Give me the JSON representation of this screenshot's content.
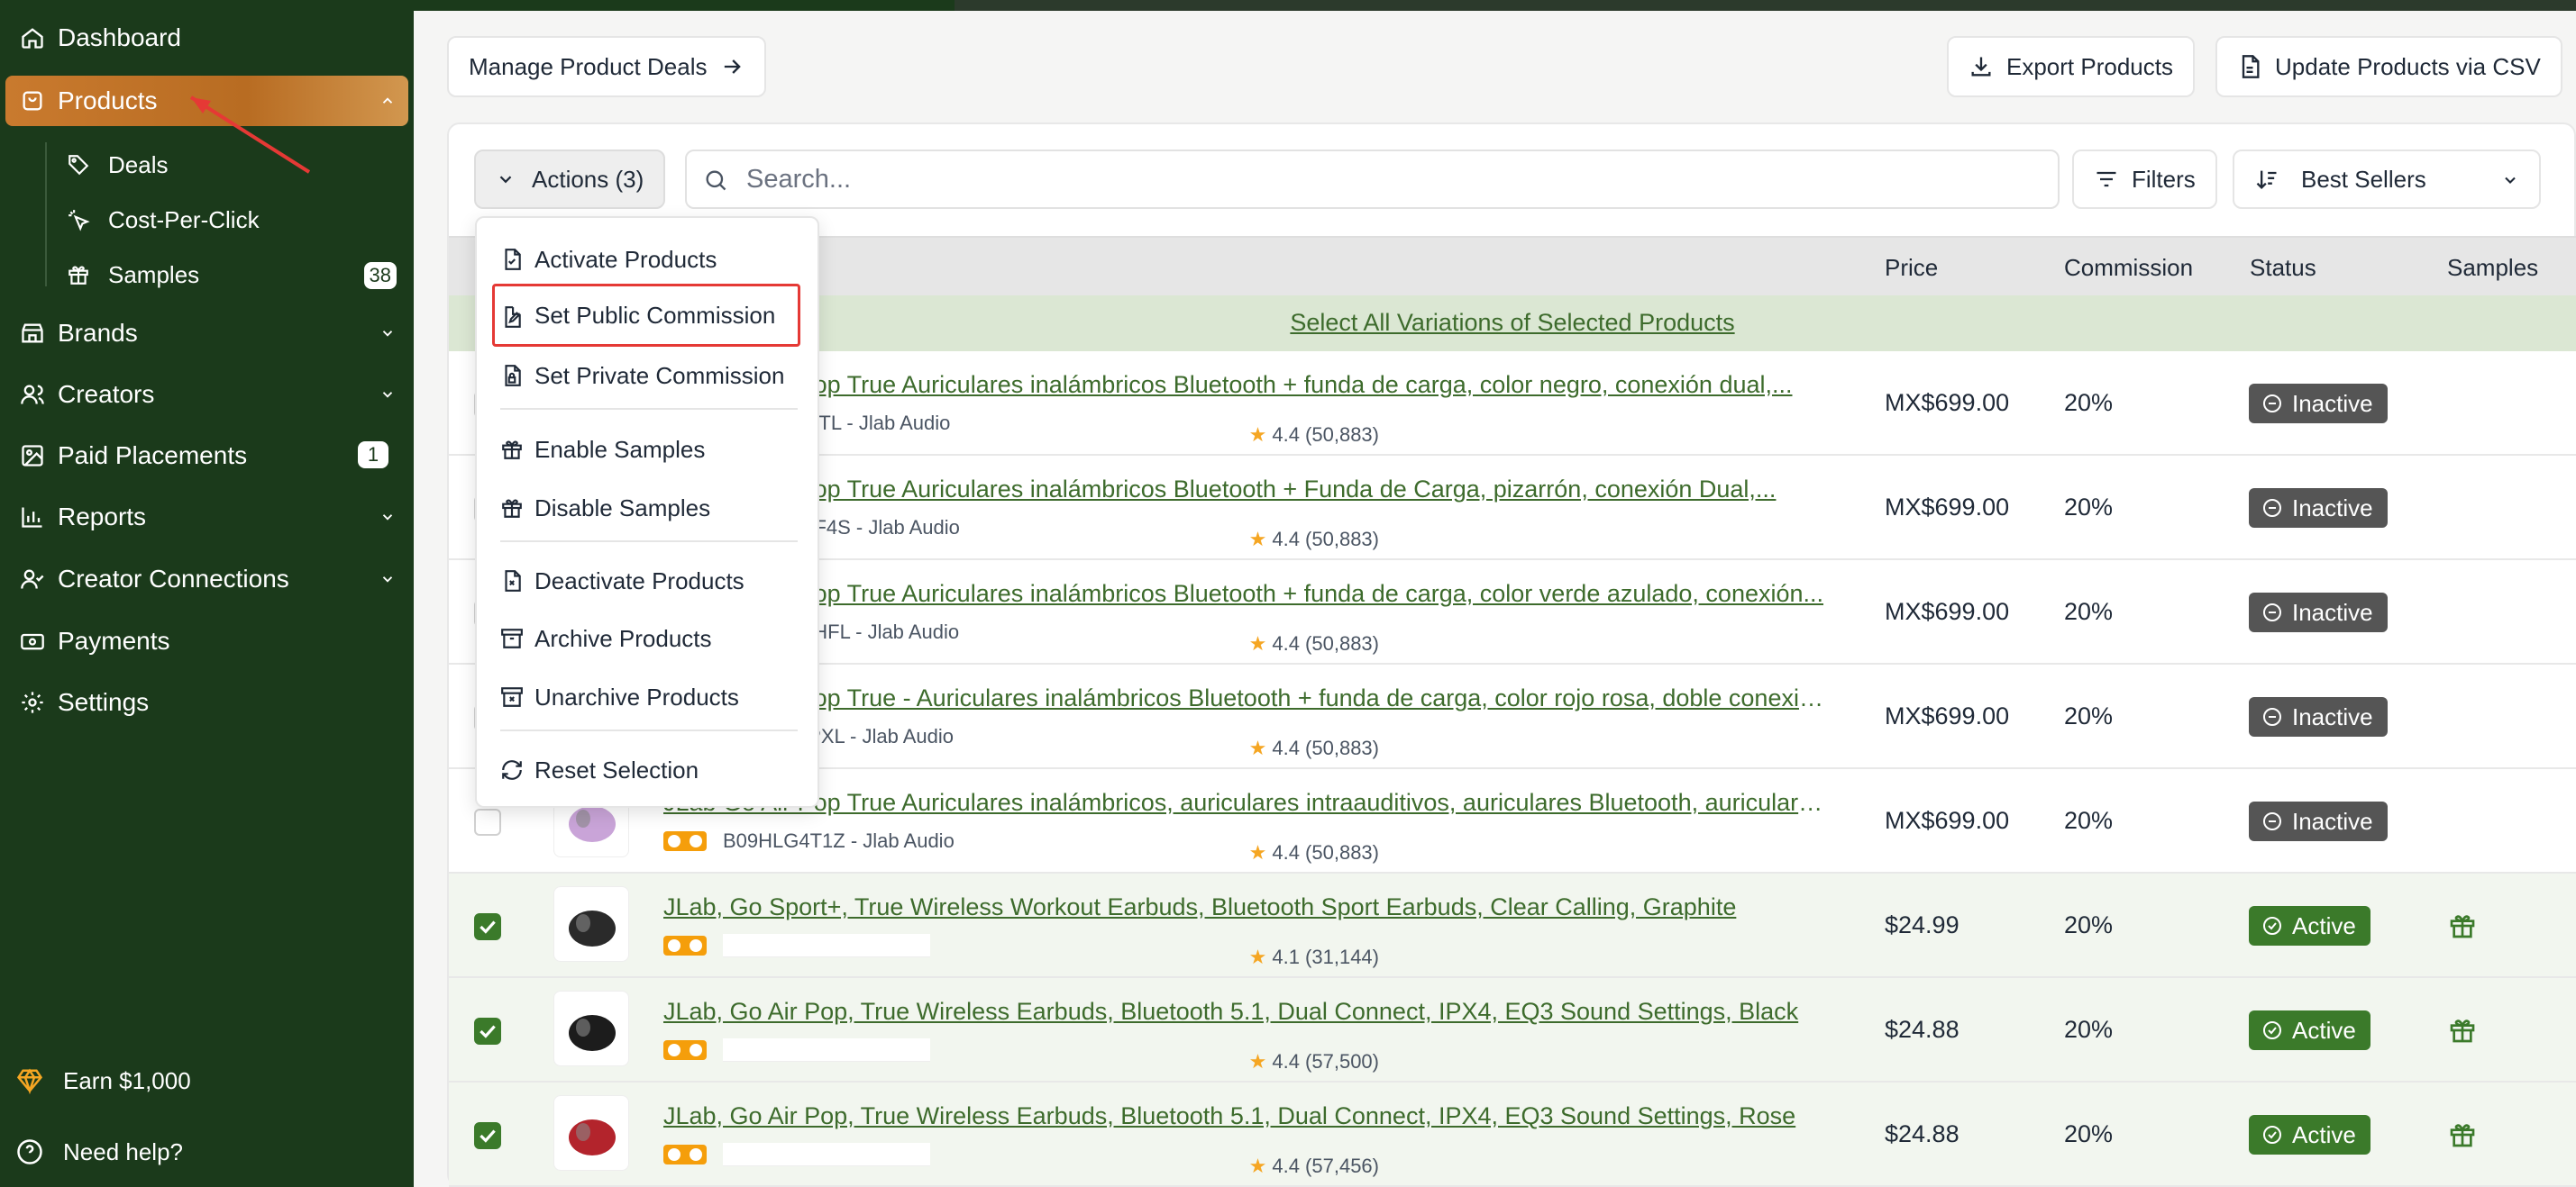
{
  "sidebar": {
    "items": [
      {
        "label": "Dashboard",
        "icon": "home-icon"
      },
      {
        "label": "Products",
        "icon": "shopping-bag-icon"
      },
      {
        "label": "Brands",
        "icon": "store-icon"
      },
      {
        "label": "Creators",
        "icon": "users-icon"
      },
      {
        "label": "Paid Placements",
        "icon": "image-icon",
        "badge": "1"
      },
      {
        "label": "Reports",
        "icon": "bar-chart-icon"
      },
      {
        "label": "Creator Connections",
        "icon": "user-check-icon"
      },
      {
        "label": "Payments",
        "icon": "wallet-icon"
      },
      {
        "label": "Settings",
        "icon": "gear-icon"
      }
    ],
    "sub_items": [
      {
        "label": "Deals",
        "icon": "tag-icon"
      },
      {
        "label": "Cost-Per-Click",
        "icon": "click-icon"
      },
      {
        "label": "Samples",
        "icon": "gift-icon",
        "badge": "38"
      }
    ],
    "bottom": {
      "earn": "Earn $1,000",
      "help": "Need help?"
    }
  },
  "toolbar": {
    "manage_deals": "Manage Product Deals",
    "export": "Export Products",
    "update_csv": "Update Products via CSV",
    "actions": "Actions (3)",
    "search_placeholder": "Search...",
    "filters": "Filters",
    "sort": "Best Sellers"
  },
  "table": {
    "headers": {
      "price": "Price",
      "commission": "Commission",
      "status": "Status",
      "samples": "Samples"
    },
    "select_all": "Select All Variations of Selected Products",
    "rows": [
      {
        "title": "JLab Go Air Pop True Auriculares inalámbricos Bluetooth + funda de carga, color negro, conexión dual,...",
        "sku": "B0B7CL54TL - Jlab Audio",
        "rating": "4.4 (50,883)",
        "price": "MX$699.00",
        "commission": "20%",
        "status": "Inactive"
      },
      {
        "title": "JLab Go Air Pop True Auriculares inalámbricos Bluetooth + Funda de Carga, pizarrón, conexión Dual,...",
        "sku": "B0B7CMTF4S - Jlab Audio",
        "rating": "4.4 (50,883)",
        "price": "MX$699.00",
        "commission": "20%",
        "status": "Inactive"
      },
      {
        "title": "JLab Go Air Pop True Auriculares inalámbricos Bluetooth + funda de carga, color verde azulado, conexión...",
        "sku": "B0B7CM7HFL - Jlab Audio",
        "rating": "4.4 (50,883)",
        "price": "MX$699.00",
        "commission": "20%",
        "status": "Inactive"
      },
      {
        "title": "JLab Go Air Pop True - Auriculares inalámbricos Bluetooth + funda de carga, color rojo rosa, doble conexió...",
        "sku": "B0B7CL9PXL - Jlab Audio",
        "rating": "4.4 (50,883)",
        "price": "MX$699.00",
        "commission": "20%",
        "status": "Inactive"
      },
      {
        "title": "JLab Go Air Pop True Auriculares inalámbricos, auriculares intraauditivos, auriculares Bluetooth, auriculares...",
        "sku": "B09HLG4T1Z - Jlab Audio",
        "rating": "4.4 (50,883)",
        "price": "MX$699.00",
        "commission": "20%",
        "status": "Inactive"
      },
      {
        "title": "JLab, Go Sport+, True Wireless Workout Earbuds, Bluetooth Sport Earbuds, Clear Calling, Graphite",
        "sku": "",
        "rating": "4.1 (31,144)",
        "price": "$24.99",
        "commission": "20%",
        "status": "Active"
      },
      {
        "title": "JLab, Go Air Pop, True Wireless Earbuds, Bluetooth 5.1, Dual Connect, IPX4, EQ3 Sound Settings, Black",
        "sku": "",
        "rating": "4.4 (57,500)",
        "price": "$24.88",
        "commission": "20%",
        "status": "Active"
      },
      {
        "title": "JLab, Go Air Pop, True Wireless Earbuds, Bluetooth 5.1, Dual Connect, IPX4, EQ3 Sound Settings, Rose",
        "sku": "",
        "rating": "4.4 (57,456)",
        "price": "$24.88",
        "commission": "20%",
        "status": "Active"
      }
    ]
  },
  "actions_menu": {
    "items": [
      {
        "label": "Activate Products",
        "icon": "file-check-icon"
      },
      {
        "label": "Set Public Commission",
        "icon": "file-edit-icon"
      },
      {
        "label": "Set Private Commission",
        "icon": "file-lock-icon"
      },
      {
        "label": "Enable Samples",
        "icon": "gift-icon"
      },
      {
        "label": "Disable Samples",
        "icon": "gift-icon"
      },
      {
        "label": "Deactivate Products",
        "icon": "file-x-icon"
      },
      {
        "label": "Archive Products",
        "icon": "archive-icon"
      },
      {
        "label": "Unarchive Products",
        "icon": "archive-x-icon"
      },
      {
        "label": "Reset Selection",
        "icon": "refresh-icon"
      }
    ]
  },
  "colors": {
    "sidebar_bg": "#1b3a1b",
    "accent_orange": "#c97a2e",
    "link_green": "#3d6b2c",
    "active_green": "#3b7a2a",
    "inactive_gray": "#555555",
    "highlight_red": "#e53935"
  }
}
